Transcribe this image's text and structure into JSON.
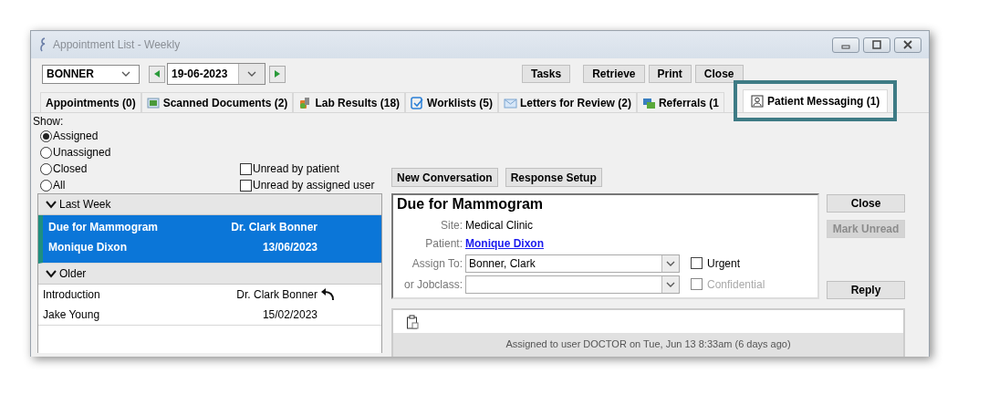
{
  "window": {
    "title": "Appointment List - Weekly"
  },
  "toolbar": {
    "provider": "BONNER",
    "date": "19-06-2023",
    "buttons": [
      "Tasks",
      "Retrieve",
      "Print",
      "Close"
    ]
  },
  "tabs": [
    {
      "label": "Appointments (0)",
      "kind": "plain",
      "selected": false,
      "callout": false
    },
    {
      "label": "Scanned Documents (2)",
      "kind": "scan",
      "selected": false,
      "callout": false
    },
    {
      "label": "Lab Results (18)",
      "kind": "lab",
      "selected": false,
      "callout": false
    },
    {
      "label": "Worklists (5)",
      "kind": "worklist",
      "selected": false,
      "callout": false
    },
    {
      "label": "Letters for Review (2)",
      "kind": "letter",
      "selected": false,
      "callout": false
    },
    {
      "label": "Referrals (1",
      "kind": "referral",
      "selected": false,
      "callout": false
    },
    {
      "label": "Patient Messaging (1)",
      "kind": "person",
      "selected": true,
      "callout": true
    }
  ],
  "filter": {
    "label": "Show:",
    "options": [
      {
        "label": "Assigned",
        "selected": true
      },
      {
        "label": "Unassigned",
        "selected": false
      },
      {
        "label": "Closed",
        "selected": false
      },
      {
        "label": "All",
        "selected": false
      }
    ],
    "checkboxes": [
      {
        "label": "Unread by patient",
        "checked": false
      },
      {
        "label": "Unread by assigned user",
        "checked": false
      }
    ]
  },
  "conversations": [
    {
      "label": "Last Week",
      "expanded": true,
      "items": [
        {
          "subject": "Due for Mammogram",
          "from": "Dr. Clark Bonner",
          "patient": "Monique Dixon",
          "date": "13/06/2023",
          "selected": true,
          "replied": false
        }
      ]
    },
    {
      "label": "Older",
      "expanded": true,
      "items": [
        {
          "subject": "Introduction",
          "from": "Dr. Clark Bonner",
          "patient": "Jake Young",
          "date": "15/02/2023",
          "selected": false,
          "replied": true
        }
      ]
    }
  ],
  "actions": [
    "New Conversation",
    "Response Setup"
  ],
  "detail": {
    "title": "Due for Mammogram",
    "fields": [
      {
        "label": "Site:",
        "value": "Medical Clinic",
        "kind": "text"
      },
      {
        "label": "Patient:",
        "value": "Monique Dixon",
        "kind": "link"
      }
    ],
    "assign_to": {
      "label": "Assign To:",
      "value": "Bonner, Clark"
    },
    "jobclass": {
      "label": "or Jobclass:"
    },
    "flags": [
      {
        "label": "Urgent",
        "checked": false,
        "disabled": false
      },
      {
        "label": "Confidential",
        "checked": false,
        "disabled": true
      }
    ]
  },
  "side_buttons": [
    {
      "label": "Close",
      "disabled": false
    },
    {
      "label": "Mark Unread",
      "disabled": true
    },
    {
      "label": "Reply",
      "disabled": false
    }
  ],
  "message": {
    "status": "Assigned to user DOCTOR on Tue, Jun 13 8:33am (6 days ago)"
  }
}
